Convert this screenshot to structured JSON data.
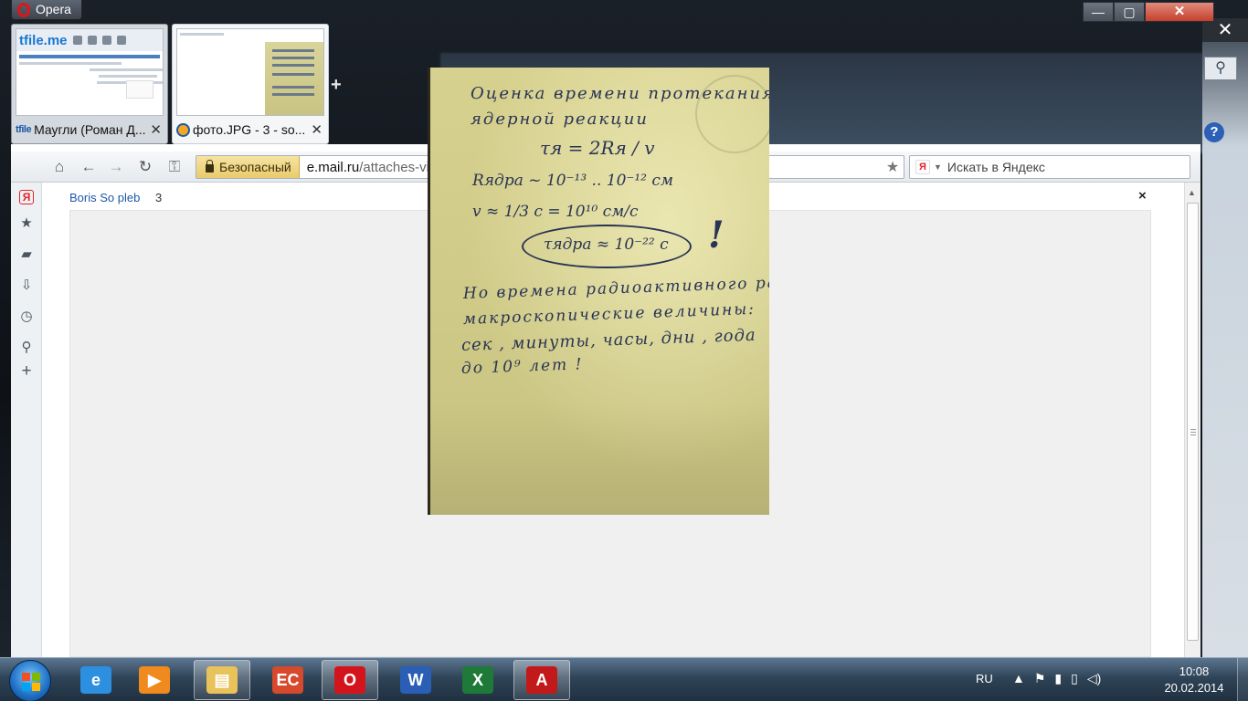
{
  "app": {
    "name": "Opera"
  },
  "window_controls": {
    "minimize": "—",
    "maximize": "▢",
    "close": "✕"
  },
  "tabs": [
    {
      "title": "Маугли (Роман Д...",
      "favicon": "tfile",
      "active": false,
      "thumb_logo": "tfile.me"
    },
    {
      "title": "фото.JPG - 3 - so...",
      "favicon": "mail",
      "active": true
    }
  ],
  "new_tab": "+",
  "toolbar": {
    "home_icon": "⌂",
    "back_icon": "←",
    "forward_icon": "→",
    "reload_icon": "↻",
    "key_icon": "⚿",
    "secure_label": "Безопасный",
    "url_host": "e.mail.ru",
    "url_path": "/attaches-viewer/",
    "bookmark_icon": "★",
    "search_engine_badge": "Я",
    "search_placeholder": "Искать в Яндекс"
  },
  "sidebar": {
    "items": [
      {
        "name": "yandex",
        "glyph": "Я"
      },
      {
        "name": "bookmarks",
        "glyph": "★"
      },
      {
        "name": "notes",
        "glyph": "▰"
      },
      {
        "name": "downloads",
        "glyph": "⇩"
      },
      {
        "name": "history",
        "glyph": "◷"
      },
      {
        "name": "search",
        "glyph": "⚲"
      },
      {
        "name": "add",
        "glyph": "+"
      }
    ]
  },
  "viewer": {
    "sender": "Boris So pleb",
    "count": "3",
    "close": "×",
    "photo_lines": {
      "l1": "Оценка времени протекания",
      "l2": "ядерной реакции",
      "l3": "τя = 2Rя / v",
      "l4": "Rядра ~ 10⁻¹³ .. 10⁻¹² см",
      "l5": "v ≈ 1/3 c = 10¹⁰ см/с",
      "l6": "τядра ≈ 10⁻²² с",
      "l7": "!",
      "l8": "Но времена радиоактивного распада",
      "l9": "макроскопические величины:",
      "l10": "сек , минуты, часы, дни , года",
      "l11": "до 10⁹ лет !"
    }
  },
  "taskbar": {
    "lang": "RU",
    "time": "10:08",
    "date": "20.02.2014",
    "apps": [
      {
        "name": "internet-explorer",
        "glyph": "e",
        "color": "#2d8fe0",
        "running": false
      },
      {
        "name": "media-player",
        "glyph": "▶",
        "color": "#f08a1e",
        "running": false
      },
      {
        "name": "explorer",
        "glyph": "▤",
        "color": "#e8c25a",
        "running": true
      },
      {
        "name": "presentation-app",
        "glyph": "EC",
        "color": "#d6492d",
        "running": false
      },
      {
        "name": "opera",
        "glyph": "O",
        "color": "#d4141c",
        "running": true
      },
      {
        "name": "word",
        "glyph": "W",
        "color": "#2b5fb5",
        "running": false
      },
      {
        "name": "excel",
        "glyph": "X",
        "color": "#1f7a3a",
        "running": false
      },
      {
        "name": "acrobat",
        "glyph": "A",
        "color": "#c21a1a",
        "running": true
      }
    ]
  }
}
